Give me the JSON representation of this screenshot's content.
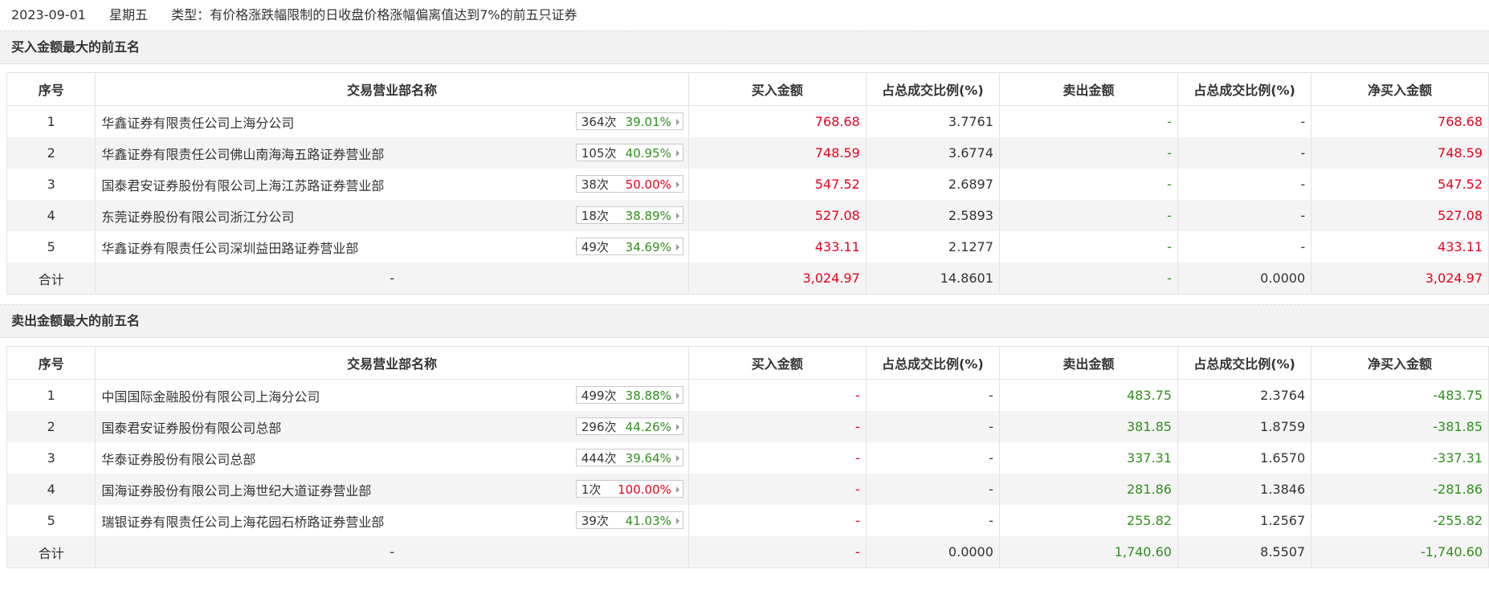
{
  "header": {
    "date": "2023-09-01",
    "weekday": "星期五",
    "type": "类型：有价格涨跌幅限制的日收盘价格涨幅偏离值达到7%的前五只证券"
  },
  "colors": {
    "red": "#e8001c",
    "green": "#2f8f1e"
  },
  "columns": [
    "序号",
    "交易营业部名称",
    "买入金额",
    "占总成交比例(%)",
    "卖出金额",
    "占总成交比例(%)",
    "净买入金额"
  ],
  "buy_section": {
    "title": "买入金额最大的前五名",
    "rows": [
      {
        "no": "1",
        "name": "华鑫证券有限责任公司上海分公司",
        "count": "364次",
        "rate": "39.01%",
        "rate_color": "green",
        "buy": "768.68",
        "buy_ratio": "3.7761",
        "sell": "-",
        "sell_ratio": "-",
        "net": "768.68"
      },
      {
        "no": "2",
        "name": "华鑫证券有限责任公司佛山南海海五路证券营业部",
        "count": "105次",
        "rate": "40.95%",
        "rate_color": "green",
        "buy": "748.59",
        "buy_ratio": "3.6774",
        "sell": "-",
        "sell_ratio": "-",
        "net": "748.59"
      },
      {
        "no": "3",
        "name": "国泰君安证券股份有限公司上海江苏路证券营业部",
        "count": "38次",
        "rate": "50.00%",
        "rate_color": "red",
        "buy": "547.52",
        "buy_ratio": "2.6897",
        "sell": "-",
        "sell_ratio": "-",
        "net": "547.52"
      },
      {
        "no": "4",
        "name": "东莞证券股份有限公司浙江分公司",
        "count": "18次",
        "rate": "38.89%",
        "rate_color": "green",
        "buy": "527.08",
        "buy_ratio": "2.5893",
        "sell": "-",
        "sell_ratio": "-",
        "net": "527.08"
      },
      {
        "no": "5",
        "name": "华鑫证券有限责任公司深圳益田路证券营业部",
        "count": "49次",
        "rate": "34.69%",
        "rate_color": "green",
        "buy": "433.11",
        "buy_ratio": "2.1277",
        "sell": "-",
        "sell_ratio": "-",
        "net": "433.11"
      }
    ],
    "total": {
      "label": "合计",
      "name": "-",
      "buy": "3,024.97",
      "buy_ratio": "14.8601",
      "sell": "-",
      "sell_ratio": "0.0000",
      "net": "3,024.97"
    }
  },
  "sell_section": {
    "title": "卖出金额最大的前五名",
    "rows": [
      {
        "no": "1",
        "name": "中国国际金融股份有限公司上海分公司",
        "count": "499次",
        "rate": "38.88%",
        "rate_color": "green",
        "buy": "-",
        "buy_ratio": "-",
        "sell": "483.75",
        "sell_ratio": "2.3764",
        "net": "-483.75"
      },
      {
        "no": "2",
        "name": "国泰君安证券股份有限公司总部",
        "count": "296次",
        "rate": "44.26%",
        "rate_color": "green",
        "buy": "-",
        "buy_ratio": "-",
        "sell": "381.85",
        "sell_ratio": "1.8759",
        "net": "-381.85"
      },
      {
        "no": "3",
        "name": "华泰证券股份有限公司总部",
        "count": "444次",
        "rate": "39.64%",
        "rate_color": "green",
        "buy": "-",
        "buy_ratio": "-",
        "sell": "337.31",
        "sell_ratio": "1.6570",
        "net": "-337.31"
      },
      {
        "no": "4",
        "name": "国海证券股份有限公司上海世纪大道证券营业部",
        "count": "1次",
        "rate": "100.00%",
        "rate_color": "red",
        "buy": "-",
        "buy_ratio": "-",
        "sell": "281.86",
        "sell_ratio": "1.3846",
        "net": "-281.86"
      },
      {
        "no": "5",
        "name": "瑞银证券有限责任公司上海花园石桥路证券营业部",
        "count": "39次",
        "rate": "41.03%",
        "rate_color": "green",
        "buy": "-",
        "buy_ratio": "-",
        "sell": "255.82",
        "sell_ratio": "1.2567",
        "net": "-255.82"
      }
    ],
    "total": {
      "label": "合计",
      "name": "-",
      "buy": "-",
      "buy_ratio": "0.0000",
      "sell": "1,740.60",
      "sell_ratio": "8.5507",
      "net": "-1,740.60"
    }
  }
}
